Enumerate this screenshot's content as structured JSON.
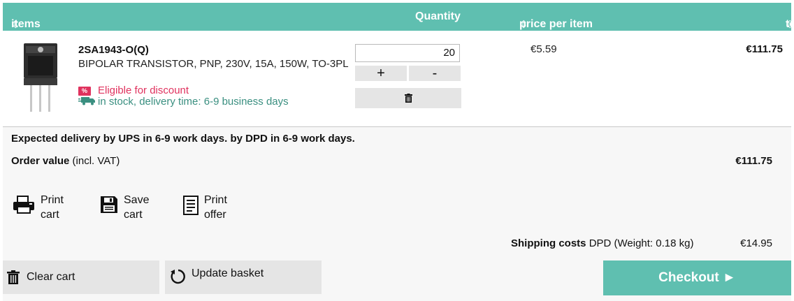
{
  "header": {
    "items_label": "items",
    "quantity_label": "Quantity",
    "price_label": "price per item",
    "total_label": "total",
    "sort_glyph": "⇳"
  },
  "item": {
    "part_number": "2SA1943-O(Q)",
    "description": "BIPOLAR TRANSISTOR, PNP, 230V, 15A, 150W, TO-3PL",
    "discount_badge": "%",
    "discount_text": "Eligible for discount",
    "stock_text": "in stock,",
    "delivery_text": "delivery time: 6-9 business days",
    "quantity": "20",
    "plus_label": "+",
    "minus_label": "-",
    "unit_price": "€5.59",
    "line_total": "€111.75"
  },
  "summary": {
    "delivery_note": "Expected delivery by UPS in 6-9 work days. by DPD in 6-9 work days.",
    "order_value_label": "Order value",
    "order_value_suffix": "(incl. VAT)",
    "order_value": "€111.75",
    "print_cart": [
      "Print",
      "cart"
    ],
    "save_cart": [
      "Save",
      "cart"
    ],
    "print_offer": [
      "Print",
      "offer"
    ],
    "shipping_label": "Shipping costs",
    "shipping_detail": "DPD (Weight: 0.18 kg)",
    "shipping_cost": "€14.95"
  },
  "actions": {
    "clear_cart": "Clear cart",
    "update_basket": "Update basket",
    "checkout": "Checkout ►"
  },
  "colors": {
    "accent": "#5fbfb0",
    "discount": "#e0325e",
    "stock": "#3a8f80",
    "button_gray": "#e5e5e5"
  }
}
